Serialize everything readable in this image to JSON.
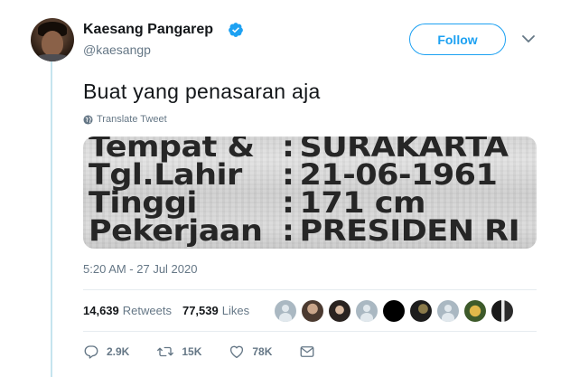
{
  "author": {
    "name": "Kaesang Pangarep",
    "handle": "@kaesangp"
  },
  "follow_label": "Follow",
  "tweet": {
    "text": "Buat yang penasaran aja",
    "translate_label": "Translate Tweet",
    "timestamp": "5:20 AM - 27 Jul 2020"
  },
  "photo": {
    "rows": [
      {
        "label": "Tempat &",
        "value": "SURAKARTA"
      },
      {
        "label": "Tgl.Lahir",
        "value": "21-06-1961"
      },
      {
        "label": "Tinggi",
        "value": "171 cm"
      },
      {
        "label": "Pekerjaan",
        "value": "PRESIDEN RI"
      }
    ],
    "colon": ":"
  },
  "stats": {
    "retweets_count": "14,639",
    "retweets_label": "Retweets",
    "likes_count": "77,539",
    "likes_label": "Likes"
  },
  "actions": {
    "replies": "2.9K",
    "retweets": "15K",
    "likes": "78K"
  },
  "colors": {
    "accent": "#1da1f2",
    "muted": "#657786",
    "thread_line": "#c5e4ee"
  }
}
